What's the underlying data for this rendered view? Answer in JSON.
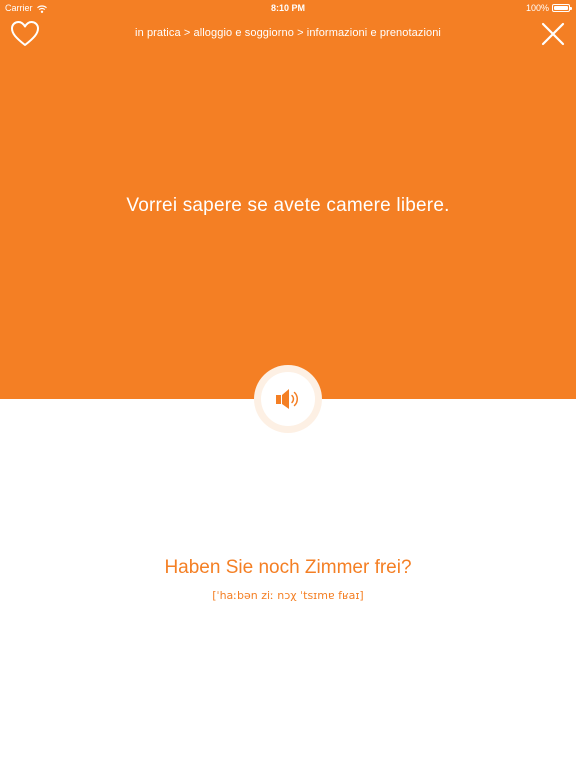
{
  "status_bar": {
    "carrier": "Carrier",
    "time": "8:10 PM",
    "battery": "100%"
  },
  "breadcrumb": "in pratica > alloggio e soggiorno > informazioni e prenotazioni",
  "source_phrase": "Vorrei sapere se avete camere libere.",
  "target_phrase": "Haben Sie noch Zimmer frei?",
  "phonetic": "[ˈhaːbən ziː nɔχ ˈtsɪmɐ fʁaɪ]",
  "icons": {
    "favorite": "heart-icon",
    "close": "close-icon",
    "audio": "speaker-icon",
    "wifi": "wifi-icon",
    "battery": "battery-icon"
  },
  "colors": {
    "accent": "#F47F24",
    "background": "#FFFFFF",
    "audio_ring": "#FDF0E4"
  }
}
